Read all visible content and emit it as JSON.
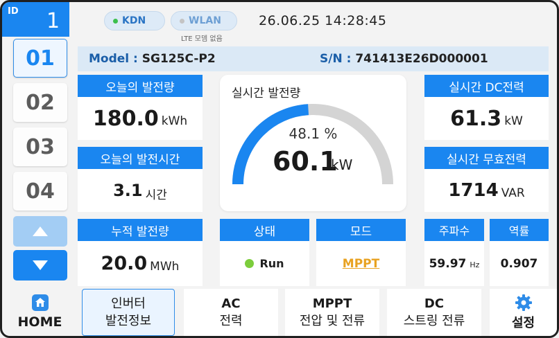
{
  "device_id": {
    "label": "ID",
    "value": "1"
  },
  "top": {
    "kdn": "KDN",
    "wlan": "WLAN",
    "lte_status": "LTE 모뎀 없음",
    "datetime": "26.06.25  14:28:45"
  },
  "devices": [
    "01",
    "02",
    "03",
    "04"
  ],
  "model": {
    "label": "Model :",
    "value": "SG125C-P2",
    "sn_label": "S/N :",
    "sn_value": "741413E26D000001"
  },
  "today_energy": {
    "label": "오늘의 발전량",
    "value": "180.0",
    "unit": "kWh"
  },
  "today_time": {
    "label": "오늘의 발전시간",
    "value": "3.1",
    "unit": "시간"
  },
  "total_energy": {
    "label": "누적 발전량",
    "value": "20.0",
    "unit": "MWh"
  },
  "gauge": {
    "title": "실시간 발전량",
    "percent_text": "48.1 %",
    "percent": 48.1,
    "value": "60.1",
    "unit": "kW"
  },
  "dc_power": {
    "label": "실시간 DC전력",
    "value": "61.3",
    "unit": "kW"
  },
  "reactive_power": {
    "label": "실시간 무효전력",
    "value": "1714",
    "unit": "VAR"
  },
  "status": {
    "label": "상태",
    "value": "Run"
  },
  "mode": {
    "label": "모드",
    "value": "MPPT"
  },
  "frequency": {
    "label": "주파수",
    "value": "59.97",
    "unit": "Hz"
  },
  "power_factor": {
    "label": "역률",
    "value": "0.907"
  },
  "nav": {
    "home": "HOME",
    "inverter_l1": "인버터",
    "inverter_l2": "발전정보",
    "ac_l1": "AC",
    "ac_l2": "전력",
    "mppt_l1": "MPPT",
    "mppt_l2": "전압 및 전류",
    "dc_l1": "DC",
    "dc_l2": "스트링 전류",
    "settings": "설정"
  },
  "colors": {
    "accent": "#1a86f0",
    "gauge_track": "#d4d4d4",
    "run_dot": "#7ccd3c",
    "mode_text": "#e8a221"
  }
}
